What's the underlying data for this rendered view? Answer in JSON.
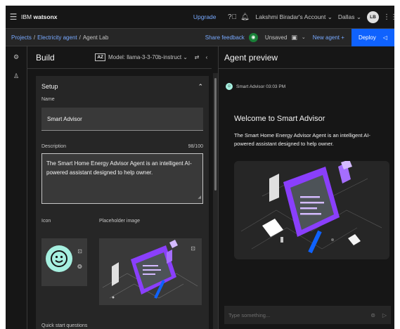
{
  "header": {
    "brand_prefix": "IBM ",
    "brand_name": "watsonx",
    "upgrade": "Upgrade",
    "account": "Lakshmi Biradar's Account",
    "region": "Dallas",
    "avatar_initials": "LB",
    "icons": [
      "hamburger-menu-icon",
      "help-icon",
      "notification-icon",
      "app-switcher-icon"
    ]
  },
  "breadcrumb": {
    "items": [
      "Projects",
      "Electricity agent",
      "Agent Lab"
    ],
    "separator": "/"
  },
  "toolbar": {
    "share_feedback": "Share feedback",
    "unsaved": "Unsaved",
    "new_agent": "New agent",
    "new_agent_plus": "+",
    "deploy": "Deploy"
  },
  "build": {
    "title": "Build",
    "model_badge": "AZ",
    "model_label": "Model: llama-3-3-70b-instruct",
    "setup": {
      "title": "Setup",
      "name_label": "Name",
      "name_value": "Smart Advisor",
      "description_label": "Description",
      "description_count": "98/100",
      "description_value": "The Smart Home Energy Advisor Agent is an intelligent AI-powered assistant designed to help owner.",
      "icon_label": "Icon",
      "placeholder_label": "Placeholder image",
      "quick_start_label": "Quick start questions"
    }
  },
  "preview": {
    "title": "Agent preview",
    "sender": "Smart Advisor",
    "time": "03:03 PM",
    "welcome_title": "Welcome to Smart Advisor",
    "welcome_text": "The Smart Home Energy Advisor Agent is an intelligent AI-powered assistant designed to help owner.",
    "input_placeholder": "Type something..."
  },
  "colors": {
    "background": "#161616",
    "panel": "#262626",
    "field": "#393939",
    "link": "#78a9ff",
    "primary": "#0f62fe",
    "accent_teal": "#a6f0e0",
    "illustration_purple": "#8a3ffc"
  }
}
